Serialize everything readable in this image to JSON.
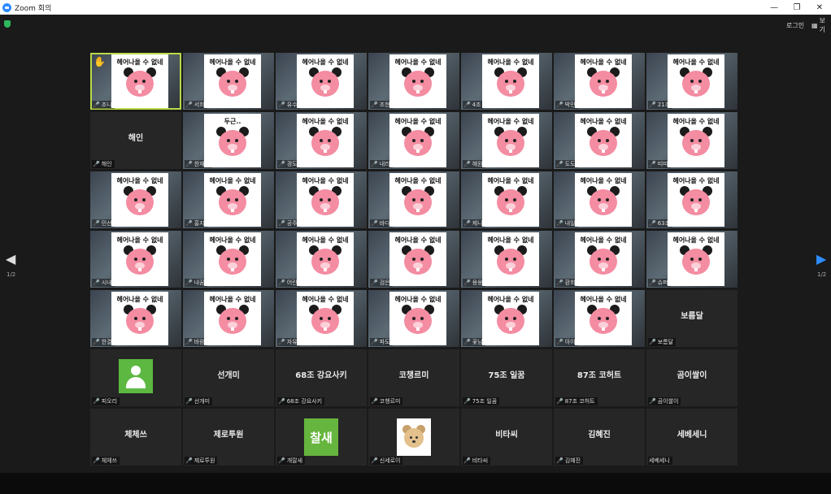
{
  "window": {
    "title": "Zoom 회의",
    "controls": [
      "—",
      "❐",
      "✕"
    ]
  },
  "topbar": {
    "login_label": "로그인",
    "view_label": "보기"
  },
  "nav": {
    "left_arrow": "◀",
    "right_arrow": "▶",
    "left_page": "1/2",
    "right_page": "1/2"
  },
  "colors": {
    "mic_muted": "#e02828",
    "active_border": "#b9d94a",
    "avatar_green": "#5cb841",
    "zoom_blue": "#2D8CFF"
  },
  "sticker": {
    "text": "헤어나올 수 없네",
    "alt_text": "두근.."
  },
  "tiles": [
    {
      "label": "조니",
      "muted": true,
      "active": true,
      "hand": true,
      "sticker": true
    },
    {
      "label": "서희",
      "muted": true,
      "sticker": true
    },
    {
      "label": "유수",
      "muted": true,
      "sticker": true
    },
    {
      "label": "조현",
      "muted": true,
      "sticker": true
    },
    {
      "label": "4조",
      "muted": true,
      "sticker": true
    },
    {
      "label": "박민",
      "muted": true,
      "sticker": true
    },
    {
      "label": "21조",
      "muted": true,
      "sticker": true
    },
    {
      "label": "해인",
      "name": "해인",
      "muted": true
    },
    {
      "label": "찬재니",
      "muted": true,
      "sticker": true,
      "sticker_alt": true
    },
    {
      "label": "경도",
      "muted": true,
      "sticker": true
    },
    {
      "label": "내리",
      "muted": true,
      "sticker": true
    },
    {
      "label": "혜원",
      "muted": true,
      "sticker": true
    },
    {
      "label": "도도",
      "muted": true,
      "sticker": true
    },
    {
      "label": "띠띠",
      "muted": true,
      "sticker": true
    },
    {
      "label": "민선",
      "muted": true,
      "sticker": true
    },
    {
      "label": "홍지",
      "muted": true,
      "sticker": true
    },
    {
      "label": "공주",
      "muted": true,
      "sticker": true
    },
    {
      "label": "바다",
      "muted": true,
      "sticker": true
    },
    {
      "label": "제니",
      "muted": true,
      "sticker": true
    },
    {
      "label": "내일",
      "muted": true,
      "sticker": true
    },
    {
      "label": "63조",
      "muted": true,
      "sticker": true
    },
    {
      "label": "시내",
      "muted": true,
      "sticker": true
    },
    {
      "label": "내꿈",
      "muted": true,
      "sticker": true
    },
    {
      "label": "어린",
      "muted": true,
      "sticker": true
    },
    {
      "label": "검은",
      "muted": true,
      "sticker": true
    },
    {
      "label": "용용",
      "muted": true,
      "sticker": true
    },
    {
      "label": "환희",
      "muted": true,
      "sticker": true
    },
    {
      "label": "슈퍼",
      "muted": true,
      "sticker": true
    },
    {
      "label": "한결",
      "muted": true,
      "sticker": true
    },
    {
      "label": "바람",
      "muted": true,
      "sticker": true
    },
    {
      "label": "자유",
      "muted": true,
      "sticker": true
    },
    {
      "label": "파도",
      "muted": true,
      "sticker": true
    },
    {
      "label": "꽃님",
      "muted": true,
      "sticker": true
    },
    {
      "label": "아이",
      "muted": true,
      "sticker": true
    },
    {
      "label": "보름달",
      "name": "보름달",
      "muted": true
    },
    {
      "label": "피오리",
      "muted": true,
      "avatar": "person"
    },
    {
      "label": "선개미",
      "name": "선개미",
      "muted": true
    },
    {
      "label": "68조 강요사키",
      "name": "68조 강요사키",
      "muted": true
    },
    {
      "label": "코챙르미",
      "name": "코챙르미",
      "muted": true
    },
    {
      "label": "75조 일꿈",
      "name": "75조 일꿈",
      "muted": true
    },
    {
      "label": "87조 코허트",
      "name": "87조 코허트",
      "muted": true
    },
    {
      "label": "곰이쌀이",
      "name": "곰이쌀이",
      "muted": true
    },
    {
      "label": "체체쓰",
      "name": "체체쓰",
      "muted": true
    },
    {
      "label": "제로투원",
      "name": "제로투원",
      "muted": true
    },
    {
      "label": "개랄새",
      "muted": true,
      "avatar": "text",
      "avatar_text": "찰새"
    },
    {
      "label": "신세로이",
      "muted": true,
      "avatar": "bear"
    },
    {
      "label": "비타씨",
      "name": "비타씨",
      "muted": true
    },
    {
      "label": "김혜진",
      "name": "김혜진",
      "muted": true
    },
    {
      "label": "세베세니",
      "name": "세베세니",
      "muted": false
    }
  ]
}
